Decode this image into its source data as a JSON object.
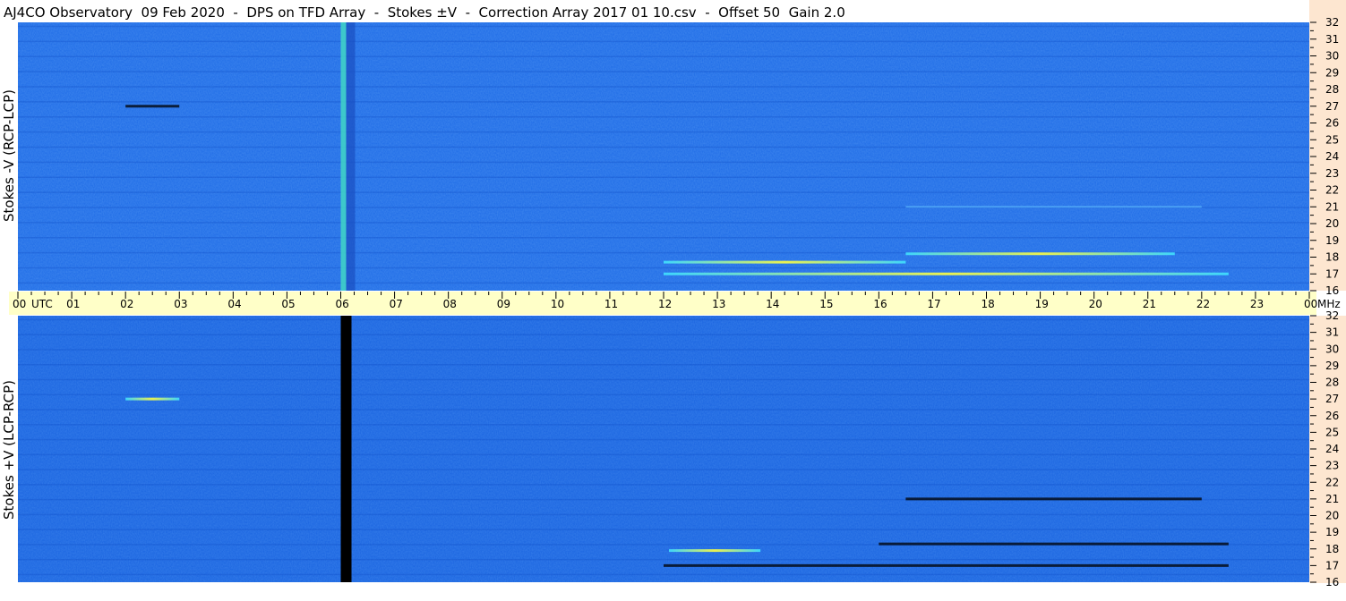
{
  "header": {
    "title": "AJ4CO Observatory  09 Feb 2020  -  DPS on TFD Array  -  Stokes ±V  -  Correction Array 2017 01 10.csv  -  Offset 50  Gain 2.0"
  },
  "colors": {
    "background_blue": "#1f6ce8",
    "time_axis_bg": "#ffffc8",
    "freq_axis_bg": "#fde6d0",
    "hot_yellow": "#ffff40",
    "dark": "#000000"
  },
  "chart_data": [
    {
      "type": "heatmap",
      "title": "",
      "ylabel": "Stokes -V (RCP-LCP)",
      "xlabel": "",
      "x_ticks": [
        "00",
        "01",
        "02",
        "03",
        "04",
        "05",
        "06",
        "07",
        "08",
        "09",
        "10",
        "11",
        "12",
        "13",
        "14",
        "15",
        "16",
        "17",
        "18",
        "19",
        "20",
        "21",
        "22",
        "23",
        "00"
      ],
      "x_unit": "UTC",
      "xlim_hours": [
        0,
        24
      ],
      "y_ticks": [
        "16",
        "17",
        "18",
        "19",
        "20",
        "21",
        "22",
        "23",
        "24",
        "25",
        "26",
        "27",
        "28",
        "29",
        "30",
        "31",
        "32"
      ],
      "y_unit": "MHz",
      "ylim_mhz": [
        16,
        32
      ],
      "features": [
        {
          "kind": "vertical_band",
          "t_hours": 6.05,
          "appearance": "bright"
        },
        {
          "kind": "emission_band",
          "t_start": 12.0,
          "t_end": 22.5,
          "f_mhz": 17.0,
          "appearance": "bright"
        },
        {
          "kind": "emission_band",
          "t_start": 12.0,
          "t_end": 16.5,
          "f_mhz": 17.7,
          "appearance": "bright"
        },
        {
          "kind": "emission_band",
          "t_start": 16.5,
          "t_end": 21.5,
          "f_mhz": 18.2,
          "appearance": "bright"
        },
        {
          "kind": "emission_band",
          "t_start": 16.5,
          "t_end": 22.0,
          "f_mhz": 21.0,
          "appearance": "faint"
        },
        {
          "kind": "emission_band",
          "t_start": 2.0,
          "t_end": 3.0,
          "f_mhz": 27.0,
          "appearance": "dark"
        }
      ]
    },
    {
      "type": "heatmap",
      "title": "",
      "ylabel": "Stokes +V (LCP-RCP)",
      "xlabel": "",
      "x_ticks": [
        "00",
        "01",
        "02",
        "03",
        "04",
        "05",
        "06",
        "07",
        "08",
        "09",
        "10",
        "11",
        "12",
        "13",
        "14",
        "15",
        "16",
        "17",
        "18",
        "19",
        "20",
        "21",
        "22",
        "23",
        "00"
      ],
      "x_unit": "UTC",
      "xlim_hours": [
        0,
        24
      ],
      "y_ticks": [
        "16",
        "17",
        "18",
        "19",
        "20",
        "21",
        "22",
        "23",
        "24",
        "25",
        "26",
        "27",
        "28",
        "29",
        "30",
        "31",
        "32"
      ],
      "y_unit": "MHz",
      "ylim_mhz": [
        16,
        32
      ],
      "features": [
        {
          "kind": "vertical_band",
          "t_hours": 6.05,
          "appearance": "dark"
        },
        {
          "kind": "emission_band",
          "t_start": 12.0,
          "t_end": 22.5,
          "f_mhz": 17.0,
          "appearance": "dark"
        },
        {
          "kind": "emission_band",
          "t_start": 12.1,
          "t_end": 13.8,
          "f_mhz": 17.9,
          "appearance": "bright"
        },
        {
          "kind": "emission_band",
          "t_start": 16.0,
          "t_end": 22.5,
          "f_mhz": 18.3,
          "appearance": "dark"
        },
        {
          "kind": "emission_band",
          "t_start": 16.5,
          "t_end": 22.0,
          "f_mhz": 21.0,
          "appearance": "dark"
        },
        {
          "kind": "emission_band",
          "t_start": 2.0,
          "t_end": 3.0,
          "f_mhz": 27.0,
          "appearance": "bright"
        }
      ]
    }
  ]
}
